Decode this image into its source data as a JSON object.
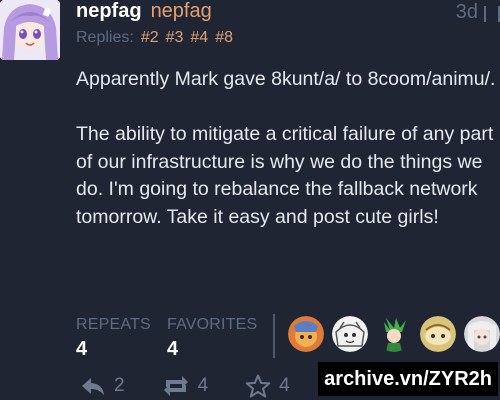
{
  "post": {
    "display_name": "nepfag",
    "username": "nepfag",
    "timestamp": "3d",
    "replies_label": "Replies:",
    "reply_links": [
      "#2",
      "#3",
      "#4",
      "#8"
    ],
    "paragraphs": [
      "Apparently Mark gave 8kunt/a/ to 8coom/animu/.",
      "The ability to mitigate a critical failure of any part of our infrastructure is why we do the things we do. I'm going to rebalance the fallback network tomorrow. Take it easy and post cute girls!"
    ],
    "stats": {
      "repeats_label": "REPEATS",
      "repeats": "4",
      "favorites_label": "FAVORITES",
      "favorites": "4"
    },
    "actions": {
      "reply_count": "2",
      "repeat_count": "4",
      "favorite_count": "4"
    }
  },
  "watermark": "archive.vn/ZYR2h",
  "colors": {
    "background": "#1f2533",
    "accent": "#e4a072",
    "muted": "#5f6b80"
  },
  "icons": {
    "avatar": "anime-girl-purple-hair",
    "reply": "reply-arrow-icon",
    "repeat": "repeat-icon",
    "favorite": "star-icon"
  }
}
